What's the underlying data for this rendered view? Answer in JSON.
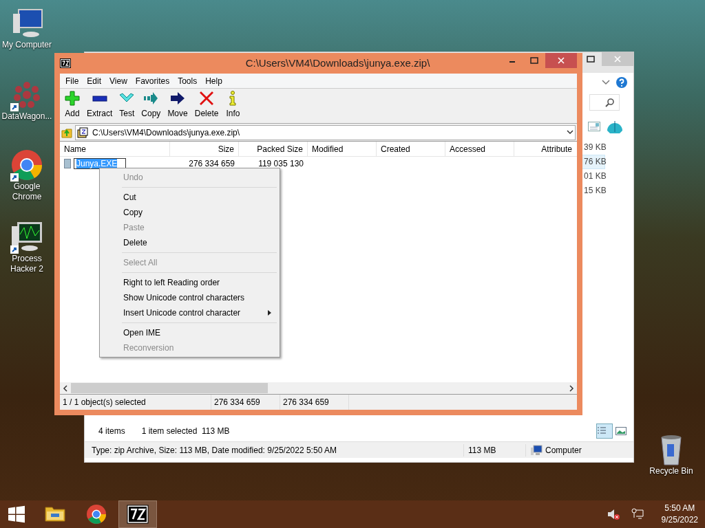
{
  "desktop_icons": [
    {
      "label": "My Computer",
      "kind": "computer",
      "shortcut": false
    },
    {
      "label": "DataWagon...",
      "kind": "datawagon",
      "shortcut": true
    },
    {
      "label": "Google Chrome",
      "kind": "chrome",
      "shortcut": true
    },
    {
      "label": "Process Hacker 2",
      "kind": "monitor",
      "shortcut": true
    },
    {
      "label": "Recycle Bin",
      "kind": "bin",
      "shortcut": false
    }
  ],
  "explorer_window": {
    "size_cells": [
      {
        "text": "39 KB",
        "selected": false
      },
      {
        "text": "76 KB",
        "selected": true
      },
      {
        "text": "01 KB",
        "selected": false
      },
      {
        "text": "15 KB",
        "selected": false
      }
    ],
    "item_count": "4 items",
    "selection_info": "1 item selected  113 MB",
    "details": "Type: zip Archive, Size: 113 MB, Date modified: 9/25/2022 5:50 AM",
    "details_size": "113 MB",
    "location": "Computer"
  },
  "sevenzip_window": {
    "title": "C:\\Users\\VM4\\Downloads\\junya.exe.zip\\",
    "menu": [
      "File",
      "Edit",
      "View",
      "Favorites",
      "Tools",
      "Help"
    ],
    "toolbar": [
      {
        "label": "Add",
        "kind": "add"
      },
      {
        "label": "Extract",
        "kind": "extract"
      },
      {
        "label": "Test",
        "kind": "test"
      },
      {
        "label": "Copy",
        "kind": "copy"
      },
      {
        "label": "Move",
        "kind": "move"
      },
      {
        "label": "Delete",
        "kind": "delete"
      },
      {
        "label": "Info",
        "kind": "info"
      }
    ],
    "address": "C:\\Users\\VM4\\Downloads\\junya.exe.zip\\",
    "columns": [
      "Name",
      "Size",
      "Packed Size",
      "Modified",
      "Created",
      "Accessed",
      "Attribute"
    ],
    "rows": [
      {
        "name": "Junya.EXE",
        "size": "276 334 659",
        "packed_size": "119 035 130",
        "selected": true,
        "editing": true
      }
    ],
    "status": [
      "1 / 1 object(s) selected",
      "276 334 659",
      "276 334 659"
    ]
  },
  "context_menu": [
    {
      "kind": "item",
      "label": "Undo",
      "disabled": true
    },
    {
      "kind": "separator"
    },
    {
      "kind": "item",
      "label": "Cut",
      "disabled": false
    },
    {
      "kind": "item",
      "label": "Copy",
      "disabled": false
    },
    {
      "kind": "item",
      "label": "Paste",
      "disabled": true
    },
    {
      "kind": "item",
      "label": "Delete",
      "disabled": false
    },
    {
      "kind": "separator"
    },
    {
      "kind": "item",
      "label": "Select All",
      "disabled": true
    },
    {
      "kind": "separator"
    },
    {
      "kind": "item",
      "label": "Right to left Reading order",
      "disabled": false
    },
    {
      "kind": "item",
      "label": "Show Unicode control characters",
      "disabled": false
    },
    {
      "kind": "item",
      "label": "Insert Unicode control character",
      "disabled": false,
      "submenu": true
    },
    {
      "kind": "separator"
    },
    {
      "kind": "item",
      "label": "Open IME",
      "disabled": false
    },
    {
      "kind": "item",
      "label": "Reconversion",
      "disabled": true
    }
  ],
  "taskbar": {
    "apps": [
      {
        "kind": "explorer",
        "selected": false
      },
      {
        "kind": "chrome",
        "selected": false
      },
      {
        "kind": "sevenzip",
        "selected": true
      }
    ],
    "time": "5:50 AM",
    "date": "9/25/2022"
  }
}
